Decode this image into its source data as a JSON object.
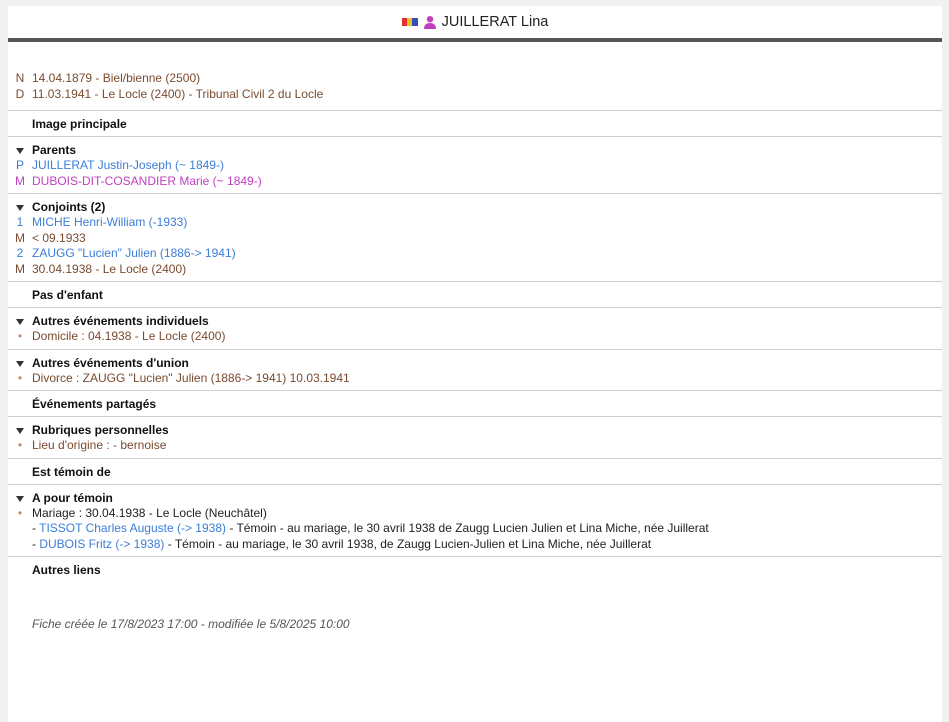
{
  "header": {
    "name": "JUILLERAT Lina",
    "flag_colors": [
      "#e03030",
      "#f0c020",
      "#3050c0"
    ],
    "person_icon_color": "#c040c0"
  },
  "facts": [
    {
      "code": "N",
      "text": "14.04.1879 - Biel/bienne (2500)"
    },
    {
      "code": "D",
      "text": "11.03.1941 - Le Locle (2400) - Tribunal Civil 2 du Locle"
    }
  ],
  "image_principale": {
    "title": "Image principale"
  },
  "parents": {
    "title": "Parents",
    "father": {
      "code": "P",
      "text": "JUILLERAT Justin-Joseph (~ 1849-)"
    },
    "mother": {
      "code": "M",
      "text": "DUBOIS-DIT-COSANDIER Marie (~ 1849-)"
    }
  },
  "conjoints": {
    "title": "Conjoints (2)",
    "items": [
      {
        "num": "1",
        "name": "MICHE Henri-William (-1933)",
        "mcode": "M",
        "marriage": "< 09.1933"
      },
      {
        "num": "2",
        "name": "ZAUGG \"Lucien\" Julien (1886-> 1941)",
        "mcode": "M",
        "marriage": "30.04.1938 - Le Locle (2400)"
      }
    ]
  },
  "enfants": {
    "title": "Pas d'enfant"
  },
  "autres_individuels": {
    "title": "Autres événements individuels",
    "items": [
      "Domicile : 04.1938 - Le Locle (2400)"
    ]
  },
  "autres_union": {
    "title": "Autres événements d'union",
    "items": [
      "Divorce : ZAUGG \"Lucien\" Julien (1886-> 1941) 10.03.1941"
    ]
  },
  "partages": {
    "title": "Événements partagés"
  },
  "rubriques": {
    "title": "Rubriques personnelles",
    "items": [
      "Lieu d'origine : - bernoise"
    ]
  },
  "temoin_de": {
    "title": "Est témoin de"
  },
  "pour_temoin": {
    "title": "A pour témoin",
    "event": "Mariage : 30.04.1938 - Le Locle (Neuchâtel)",
    "witnesses": [
      {
        "prefix": "- ",
        "link": "TISSOT Charles Auguste (-> 1938)",
        "desc": " - Témoin - au mariage, le 30 avril 1938 de Zaugg Lucien Julien et Lina Miche, née Juillerat"
      },
      {
        "prefix": "- ",
        "link": "DUBOIS Fritz (-> 1938)",
        "desc": " - Témoin - au mariage, le 30 avril 1938, de Zaugg Lucien-Julien et Lina Miche, née Juillerat"
      }
    ]
  },
  "autres_liens": {
    "title": "Autres liens"
  },
  "footer": {
    "text": "Fiche créée le 17/8/2023 17:00 - modifiée le 5/8/2025 10:00"
  }
}
